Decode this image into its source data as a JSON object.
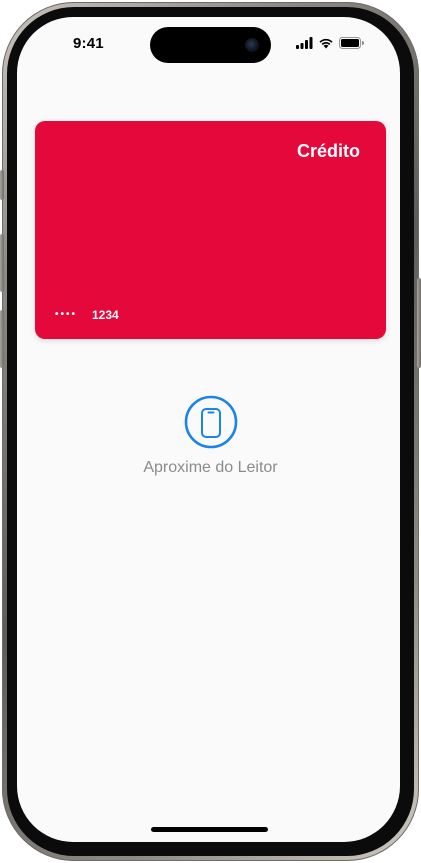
{
  "status_bar": {
    "time": "9:41"
  },
  "card": {
    "type_label": "Crédito",
    "masked_dots": "••••",
    "last_four": "1234",
    "color": "#E5083B"
  },
  "reader": {
    "icon": "phone-reader-icon",
    "label": "Aproxime do Leitor",
    "accent_color": "#1A84E8"
  }
}
